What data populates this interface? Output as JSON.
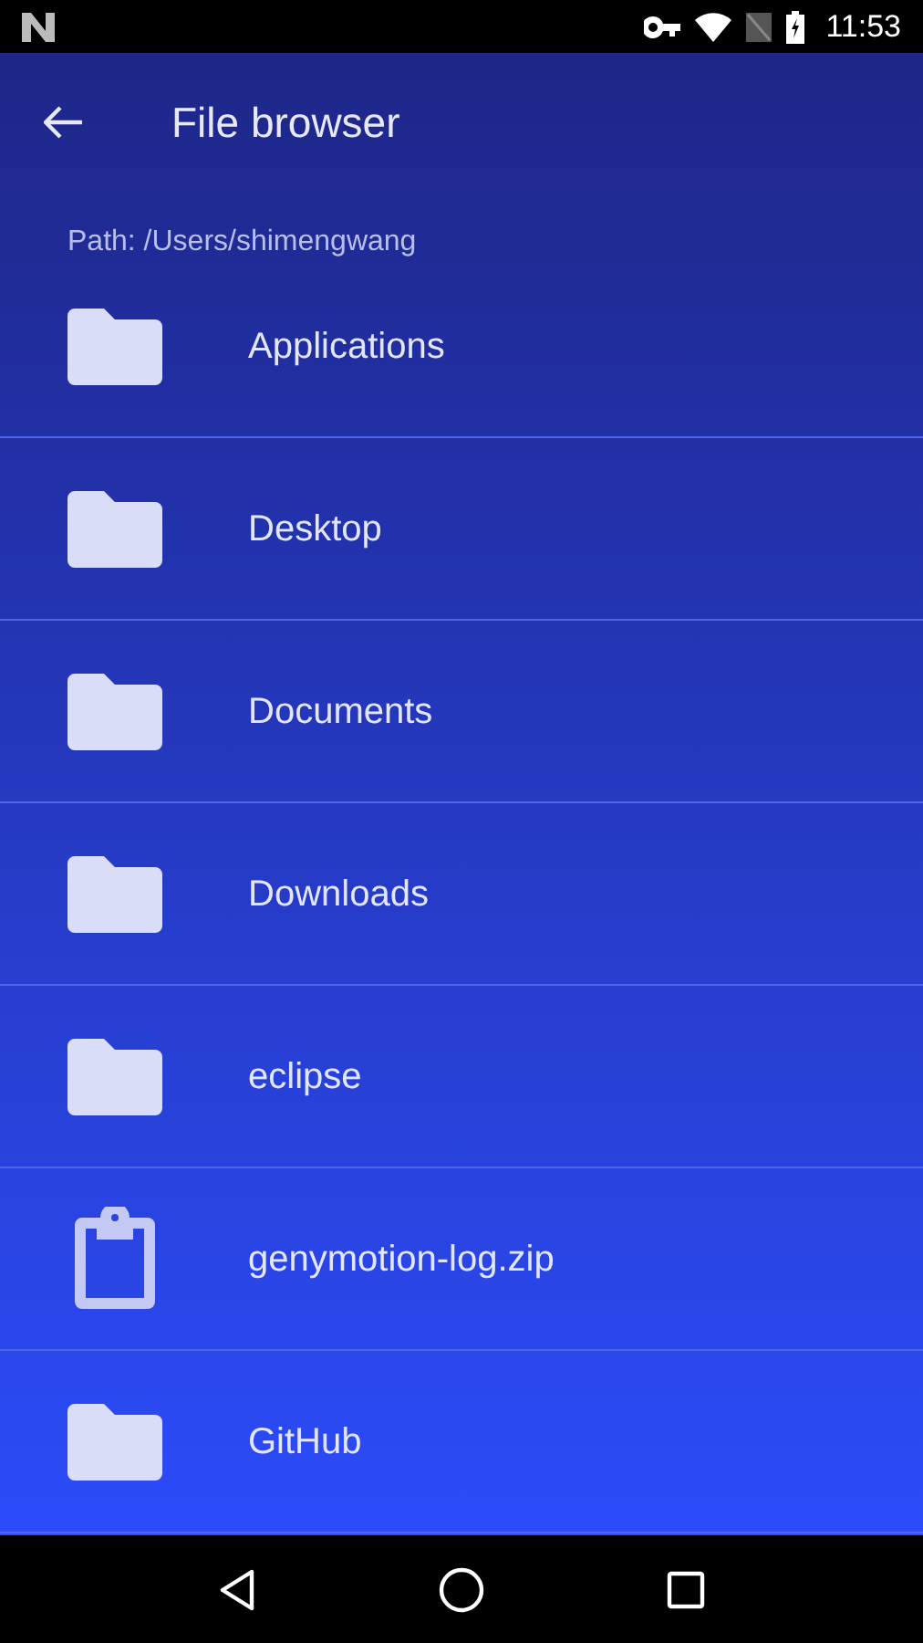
{
  "status_bar": {
    "time": "11:53"
  },
  "app_bar": {
    "title": "File browser"
  },
  "path": "Path: /Users/shimengwang",
  "items": [
    {
      "name": "Applications",
      "kind": "folder"
    },
    {
      "name": "Desktop",
      "kind": "folder"
    },
    {
      "name": "Documents",
      "kind": "folder"
    },
    {
      "name": "Downloads",
      "kind": "folder"
    },
    {
      "name": "eclipse",
      "kind": "folder"
    },
    {
      "name": "genymotion-log.zip",
      "kind": "file"
    },
    {
      "name": "GitHub",
      "kind": "folder"
    }
  ]
}
